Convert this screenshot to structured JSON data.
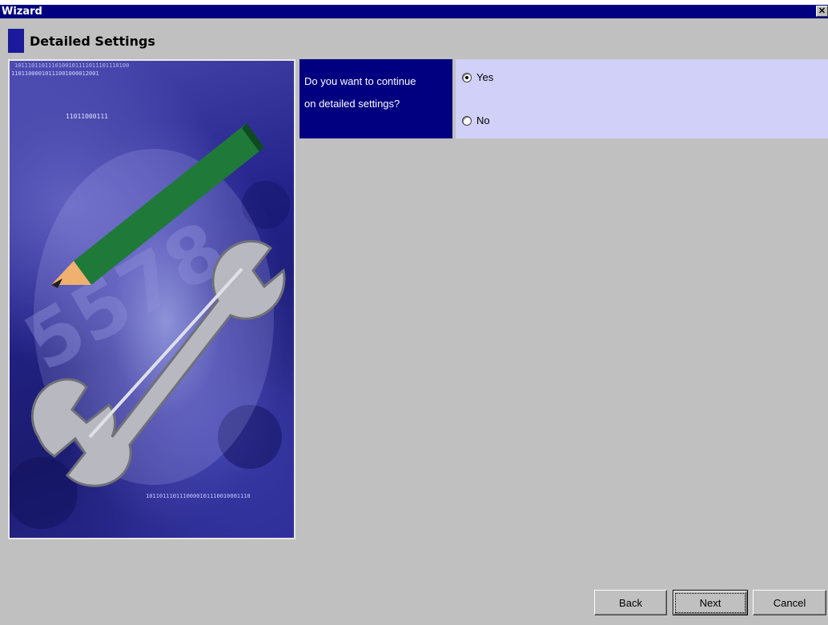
{
  "window": {
    "title": "Wizard",
    "close_label": "✕"
  },
  "step": {
    "title": "Detailed Settings"
  },
  "question": {
    "line1": "Do you want to continue",
    "line2": "on detailed settings?"
  },
  "options": [
    {
      "label": "Yes",
      "selected": true
    },
    {
      "label": "No",
      "selected": false
    }
  ],
  "buttons": {
    "back": "Back",
    "next": "Next",
    "cancel": "Cancel"
  },
  "illustration": {
    "binary_top_1": "1011101101110100101111011101110100",
    "binary_top_2": "11011000010111001000012001",
    "binary_top_3": "11011000111",
    "binary_bottom": "1011011101110000101110010001110",
    "digits": "5578"
  },
  "colors": {
    "title_bar": "#000080",
    "question_bg": "#000080",
    "options_bg": "#d0d0f8",
    "step_marker": "#1a1a9a"
  },
  "icons": [
    "close-icon",
    "pencil-icon",
    "wrench-icon"
  ]
}
